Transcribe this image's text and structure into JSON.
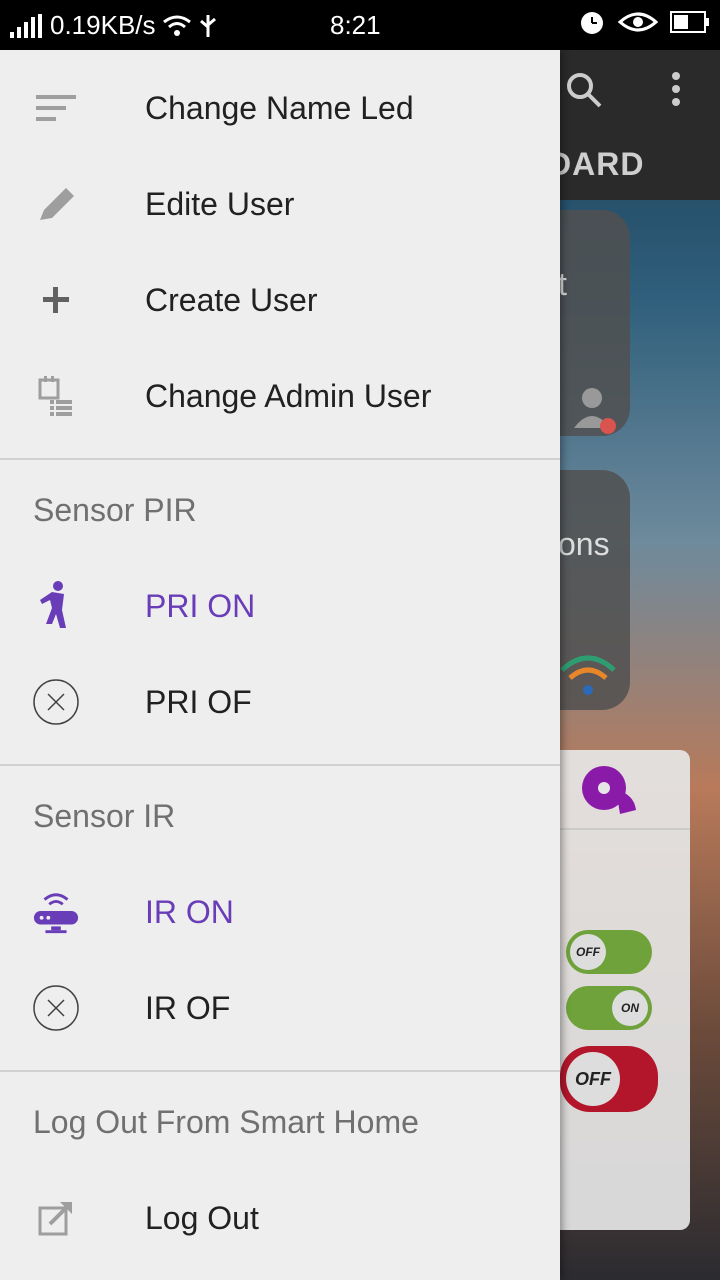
{
  "status_bar": {
    "speed": "0.19KB/s",
    "time": "8:21"
  },
  "background_app": {
    "tab_fragment": "DARD",
    "card1_fragment": "t",
    "card2_fragment": "ons",
    "toggles": [
      "OFF",
      "ON",
      "OFF"
    ]
  },
  "drawer": {
    "items_top": [
      {
        "label": "Change Name Led",
        "icon": "sort-lines-icon"
      },
      {
        "label": "Edite User",
        "icon": "pencil-icon"
      },
      {
        "label": "Create User",
        "icon": "plus-icon"
      },
      {
        "label": "Change Admin User",
        "icon": "calendar-list-icon"
      }
    ],
    "section_pir": {
      "title": "Sensor PIR",
      "items": [
        {
          "label": "PRI ON",
          "icon": "walking-person-icon",
          "active": true
        },
        {
          "label": "PRI OF",
          "icon": "circle-x-icon",
          "active": false
        }
      ]
    },
    "section_ir": {
      "title": "Sensor IR",
      "items": [
        {
          "label": "IR ON",
          "icon": "router-wifi-icon",
          "active": true
        },
        {
          "label": "IR OF",
          "icon": "circle-x-icon",
          "active": false
        }
      ]
    },
    "section_logout": {
      "title": "Log Out From Smart Home",
      "items": [
        {
          "label": "Log Out",
          "icon": "external-edit-icon"
        }
      ]
    }
  },
  "colors": {
    "accent": "#6a3db8",
    "drawer_bg": "#eeeeee",
    "icon_gray": "#9e9e9e"
  }
}
